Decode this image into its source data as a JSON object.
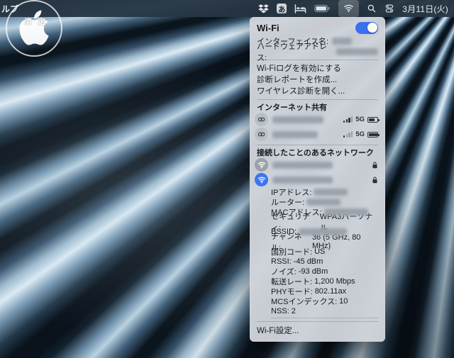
{
  "menu_bar": {
    "app_menu_partial": "ルプ",
    "input_source_label": "あ",
    "date": "3月11日(火)",
    "icons": [
      "dropbox",
      "input-source",
      "bed",
      "battery",
      "wifi",
      "spotlight",
      "stacked-toggles"
    ]
  },
  "watermark": {
    "logo": "apple",
    "chars": {
      "c1": "済",
      "c2": "定"
    }
  },
  "wifi_menu": {
    "title": "Wi-Fi",
    "toggle_on": true,
    "info_fields": [
      {
        "label": "インターフェイス名:",
        "redacted": true
      },
      {
        "label": "ハードウェアアドレス:",
        "redacted": true
      }
    ],
    "actions": [
      "Wi-Fiログを有効にする",
      "診断レポートを作成...",
      "ワイヤレス診断を開く..."
    ],
    "internet_sharing": {
      "header": "インターネット共有",
      "devices": [
        {
          "name_redacted": true,
          "network": "5G",
          "signal_bars": 3
        },
        {
          "name_redacted": true,
          "network": "5G",
          "signal_bars": 1
        }
      ]
    },
    "known_networks": {
      "header": "接続したことのあるネットワーク",
      "items": [
        {
          "connected": false,
          "secured": true,
          "name_redacted": true
        },
        {
          "connected": true,
          "secured": true,
          "name_redacted": true
        }
      ]
    },
    "details": [
      {
        "label": "IPアドレス:",
        "value": "",
        "redacted": true
      },
      {
        "label": "ルーター:",
        "value": "",
        "redacted": true
      },
      {
        "label": "MACアドレス:",
        "value": "",
        "redacted": true
      },
      {
        "label": "セキュリティ:",
        "value": "WPA3パーソナル"
      },
      {
        "label": "BSSID:",
        "value": "",
        "redacted": true
      },
      {
        "label": "チャンネル:",
        "value": "36 (5 GHz, 80 MHz)"
      },
      {
        "label": "国別コード:",
        "value": "US"
      },
      {
        "label": "RSSI:",
        "value": "-45 dBm"
      },
      {
        "label": "ノイズ:",
        "value": "-93 dBm"
      },
      {
        "label": "転送レート:",
        "value": "1,200 Mbps"
      },
      {
        "label": "PHYモード:",
        "value": "802.11ax"
      },
      {
        "label": "MCSインデックス:",
        "value": "10"
      },
      {
        "label": "NSS:",
        "value": "2"
      }
    ],
    "footer": "Wi-Fi設定..."
  },
  "colors": {
    "accent": "#3a6ff0",
    "menubar_bg": "#283744",
    "panel_bg": "#ced3d9"
  }
}
